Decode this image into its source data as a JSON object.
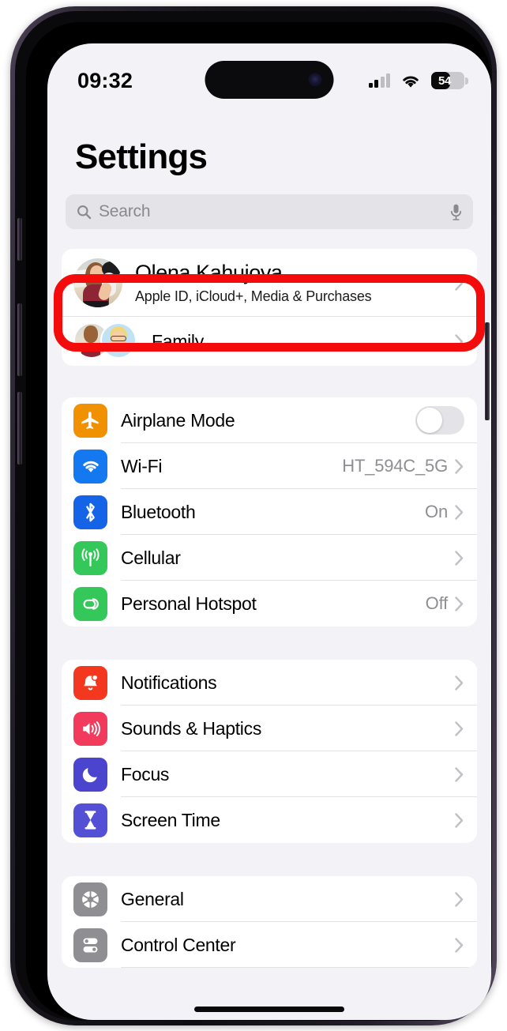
{
  "status_bar": {
    "time": "09:32",
    "battery_percent": "54",
    "signal_icon": "cellular-signal-icon",
    "wifi_icon": "wifi-icon",
    "battery_icon": "battery-icon"
  },
  "header": {
    "title": "Settings"
  },
  "search": {
    "placeholder": "Search",
    "search_icon": "search-icon",
    "mic_icon": "microphone-icon"
  },
  "account": {
    "name": "Olena Kahujova",
    "subtitle": "Apple ID, iCloud+, Media & Purchases",
    "avatar_icon": "user-avatar",
    "highlighted": true,
    "highlight_color": "#f40b0b"
  },
  "family": {
    "label": "Family",
    "avatars_icon": "family-avatars"
  },
  "groups": [
    {
      "id": "connectivity",
      "rows": [
        {
          "label": "Airplane Mode",
          "value": "",
          "icon": "airplane-icon",
          "icon_color": "#f29100",
          "control": "toggle",
          "toggle_on": false
        },
        {
          "label": "Wi-Fi",
          "value": "HT_594C_5G",
          "icon": "wifi-icon",
          "icon_color": "#1478f0",
          "control": "chevron"
        },
        {
          "label": "Bluetooth",
          "value": "On",
          "icon": "bluetooth-icon",
          "icon_color": "#1564e8",
          "control": "chevron"
        },
        {
          "label": "Cellular",
          "value": "",
          "icon": "cellular-icon",
          "icon_color": "#34c759",
          "control": "chevron"
        },
        {
          "label": "Personal Hotspot",
          "value": "Off",
          "icon": "hotspot-icon",
          "icon_color": "#34c759",
          "control": "chevron"
        }
      ]
    },
    {
      "id": "notifications",
      "rows": [
        {
          "label": "Notifications",
          "value": "",
          "icon": "bell-icon",
          "icon_color": "#f4371f",
          "control": "chevron"
        },
        {
          "label": "Sounds & Haptics",
          "value": "",
          "icon": "speaker-icon",
          "icon_color": "#f23a5c",
          "control": "chevron"
        },
        {
          "label": "Focus",
          "value": "",
          "icon": "moon-icon",
          "icon_color": "#4b44cf",
          "control": "chevron"
        },
        {
          "label": "Screen Time",
          "value": "",
          "icon": "hourglass-icon",
          "icon_color": "#5350d6",
          "control": "chevron"
        }
      ]
    },
    {
      "id": "general",
      "rows": [
        {
          "label": "General",
          "value": "",
          "icon": "gear-icon",
          "icon_color": "#8e8e93",
          "control": "chevron"
        },
        {
          "label": "Control Center",
          "value": "",
          "icon": "control-center-icon",
          "icon_color": "#8e8e93",
          "control": "chevron"
        }
      ]
    }
  ]
}
